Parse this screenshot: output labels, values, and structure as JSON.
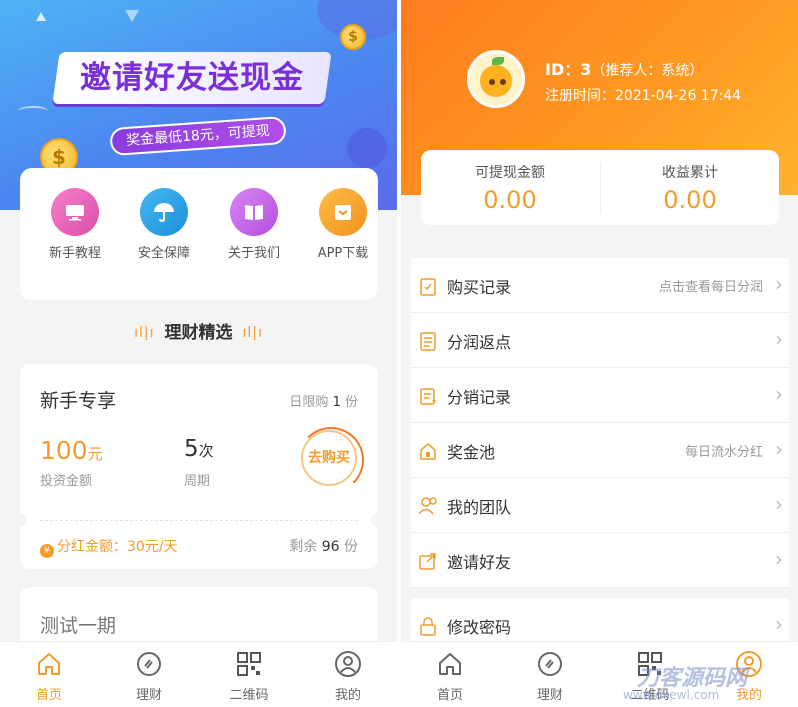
{
  "left": {
    "banner": {
      "title": "邀请好友送现金",
      "subtitle": "奖金最低18元，可提现"
    },
    "quick_links": [
      {
        "label": "新手教程",
        "icon": "monitor-icon",
        "color": "#e85fb8"
      },
      {
        "label": "安全保障",
        "icon": "umbrella-icon",
        "color": "#2b9fe6"
      },
      {
        "label": "关于我们",
        "icon": "book-icon",
        "color": "#c262e6"
      },
      {
        "label": "APP下载",
        "icon": "download-icon",
        "color": "#f59a26"
      }
    ],
    "section_title": "理财精选",
    "product": {
      "title": "新手专享",
      "limit_label": "日限购",
      "limit_value": "1",
      "limit_unit": "份",
      "amount": "100",
      "amount_unit": "元",
      "amount_label": "投资金额",
      "period": "5",
      "period_unit": "次",
      "period_label": "周期",
      "buy_label": "去购买",
      "dividend": "分红金额：30元/天",
      "remaining_label": "剩余",
      "remaining_value": "96",
      "remaining_unit": "份"
    },
    "product2": {
      "title": "测试一期"
    },
    "tabbar": [
      {
        "label": "首页",
        "icon": "home-icon",
        "active": true
      },
      {
        "label": "理财",
        "icon": "finance-icon",
        "active": false
      },
      {
        "label": "二维码",
        "icon": "qrcode-icon",
        "active": false
      },
      {
        "label": "我的",
        "icon": "user-icon",
        "active": false
      }
    ]
  },
  "right": {
    "user": {
      "id_label": "ID：3",
      "referrer": "（推荐人：系统）",
      "register": "注册时间：2021-04-26 17:44"
    },
    "stats": [
      {
        "label": "可提现金额",
        "value": "0.00"
      },
      {
        "label": "收益累计",
        "value": "0.00"
      }
    ],
    "menu": [
      {
        "label": "购买记录",
        "right": "点击查看每日分润",
        "icon": "clipboard-icon"
      },
      {
        "label": "分润返点",
        "right": "",
        "icon": "list-icon"
      },
      {
        "label": "分销记录",
        "right": "",
        "icon": "notes-icon"
      },
      {
        "label": "奖金池",
        "right": "每日流水分红",
        "icon": "house-icon"
      },
      {
        "label": "我的团队",
        "right": "",
        "icon": "team-icon"
      },
      {
        "label": "邀请好友",
        "right": "",
        "icon": "share-icon"
      }
    ],
    "menu2": {
      "label": "修改密码",
      "icon": "lock-icon"
    },
    "tabbar": [
      {
        "label": "首页",
        "icon": "home-icon"
      },
      {
        "label": "理财",
        "icon": "finance-icon"
      },
      {
        "label": "二维码",
        "icon": "qrcode-icon"
      },
      {
        "label": "我的",
        "icon": "user-icon"
      }
    ],
    "watermark": "刀客源码网",
    "watermark_url": "www.dkewl.com"
  },
  "colors": {
    "accent": "#f39c2c",
    "banner_blue": "#4c86f0",
    "header_orange": "#ff8a1f"
  }
}
